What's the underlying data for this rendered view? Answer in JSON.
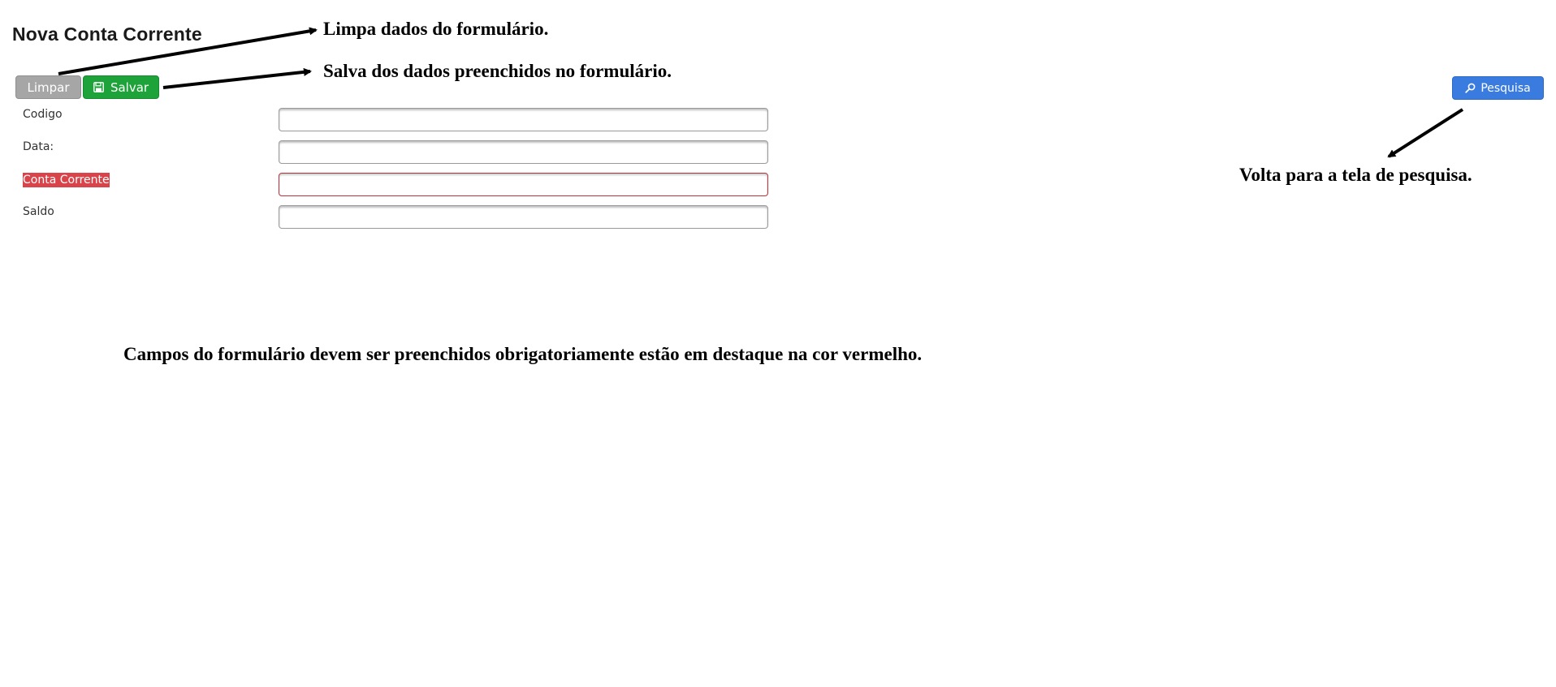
{
  "page": {
    "title": "Nova Conta Corrente"
  },
  "toolbar": {
    "limpar_label": "Limpar",
    "salvar_label": "Salvar",
    "pesquisa_label": "Pesquisa",
    "salvar_icon": "save-icon",
    "pesquisa_icon": "search-icon"
  },
  "form": {
    "fields": [
      {
        "label": "Codigo",
        "value": "",
        "required": false
      },
      {
        "label": "Data:",
        "value": "",
        "required": false
      },
      {
        "label": "Conta Corrente",
        "value": "",
        "required": true
      },
      {
        "label": "Saldo",
        "value": "",
        "required": false
      }
    ]
  },
  "annotations": {
    "limpar": "Limpa dados do formulário.",
    "salvar": "Salva dos dados preenchidos no formulário.",
    "pesquisa": "Volta para a tela de pesquisa.",
    "campos": "Campos do formulário devem ser preenchidos obrigatoriamente estão em destaque na cor vermelho."
  },
  "colors": {
    "limpar_button": "#a6a6a6",
    "salvar_button": "#1ea33a",
    "pesquisa_button": "#3a7be0",
    "required_highlight": "#d9434a",
    "annotation_text": "#000000"
  }
}
